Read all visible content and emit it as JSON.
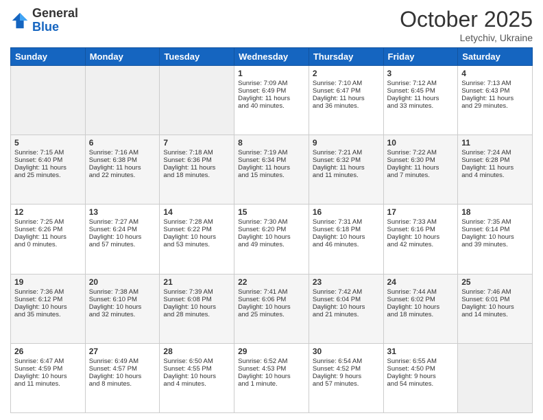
{
  "header": {
    "logo_general": "General",
    "logo_blue": "Blue",
    "month": "October 2025",
    "location": "Letychiv, Ukraine"
  },
  "weekdays": [
    "Sunday",
    "Monday",
    "Tuesday",
    "Wednesday",
    "Thursday",
    "Friday",
    "Saturday"
  ],
  "rows": [
    [
      {
        "day": "",
        "info": ""
      },
      {
        "day": "",
        "info": ""
      },
      {
        "day": "",
        "info": ""
      },
      {
        "day": "1",
        "info": "Sunrise: 7:09 AM\nSunset: 6:49 PM\nDaylight: 11 hours\nand 40 minutes."
      },
      {
        "day": "2",
        "info": "Sunrise: 7:10 AM\nSunset: 6:47 PM\nDaylight: 11 hours\nand 36 minutes."
      },
      {
        "day": "3",
        "info": "Sunrise: 7:12 AM\nSunset: 6:45 PM\nDaylight: 11 hours\nand 33 minutes."
      },
      {
        "day": "4",
        "info": "Sunrise: 7:13 AM\nSunset: 6:43 PM\nDaylight: 11 hours\nand 29 minutes."
      }
    ],
    [
      {
        "day": "5",
        "info": "Sunrise: 7:15 AM\nSunset: 6:40 PM\nDaylight: 11 hours\nand 25 minutes."
      },
      {
        "day": "6",
        "info": "Sunrise: 7:16 AM\nSunset: 6:38 PM\nDaylight: 11 hours\nand 22 minutes."
      },
      {
        "day": "7",
        "info": "Sunrise: 7:18 AM\nSunset: 6:36 PM\nDaylight: 11 hours\nand 18 minutes."
      },
      {
        "day": "8",
        "info": "Sunrise: 7:19 AM\nSunset: 6:34 PM\nDaylight: 11 hours\nand 15 minutes."
      },
      {
        "day": "9",
        "info": "Sunrise: 7:21 AM\nSunset: 6:32 PM\nDaylight: 11 hours\nand 11 minutes."
      },
      {
        "day": "10",
        "info": "Sunrise: 7:22 AM\nSunset: 6:30 PM\nDaylight: 11 hours\nand 7 minutes."
      },
      {
        "day": "11",
        "info": "Sunrise: 7:24 AM\nSunset: 6:28 PM\nDaylight: 11 hours\nand 4 minutes."
      }
    ],
    [
      {
        "day": "12",
        "info": "Sunrise: 7:25 AM\nSunset: 6:26 PM\nDaylight: 11 hours\nand 0 minutes."
      },
      {
        "day": "13",
        "info": "Sunrise: 7:27 AM\nSunset: 6:24 PM\nDaylight: 10 hours\nand 57 minutes."
      },
      {
        "day": "14",
        "info": "Sunrise: 7:28 AM\nSunset: 6:22 PM\nDaylight: 10 hours\nand 53 minutes."
      },
      {
        "day": "15",
        "info": "Sunrise: 7:30 AM\nSunset: 6:20 PM\nDaylight: 10 hours\nand 49 minutes."
      },
      {
        "day": "16",
        "info": "Sunrise: 7:31 AM\nSunset: 6:18 PM\nDaylight: 10 hours\nand 46 minutes."
      },
      {
        "day": "17",
        "info": "Sunrise: 7:33 AM\nSunset: 6:16 PM\nDaylight: 10 hours\nand 42 minutes."
      },
      {
        "day": "18",
        "info": "Sunrise: 7:35 AM\nSunset: 6:14 PM\nDaylight: 10 hours\nand 39 minutes."
      }
    ],
    [
      {
        "day": "19",
        "info": "Sunrise: 7:36 AM\nSunset: 6:12 PM\nDaylight: 10 hours\nand 35 minutes."
      },
      {
        "day": "20",
        "info": "Sunrise: 7:38 AM\nSunset: 6:10 PM\nDaylight: 10 hours\nand 32 minutes."
      },
      {
        "day": "21",
        "info": "Sunrise: 7:39 AM\nSunset: 6:08 PM\nDaylight: 10 hours\nand 28 minutes."
      },
      {
        "day": "22",
        "info": "Sunrise: 7:41 AM\nSunset: 6:06 PM\nDaylight: 10 hours\nand 25 minutes."
      },
      {
        "day": "23",
        "info": "Sunrise: 7:42 AM\nSunset: 6:04 PM\nDaylight: 10 hours\nand 21 minutes."
      },
      {
        "day": "24",
        "info": "Sunrise: 7:44 AM\nSunset: 6:02 PM\nDaylight: 10 hours\nand 18 minutes."
      },
      {
        "day": "25",
        "info": "Sunrise: 7:46 AM\nSunset: 6:01 PM\nDaylight: 10 hours\nand 14 minutes."
      }
    ],
    [
      {
        "day": "26",
        "info": "Sunrise: 6:47 AM\nSunset: 4:59 PM\nDaylight: 10 hours\nand 11 minutes."
      },
      {
        "day": "27",
        "info": "Sunrise: 6:49 AM\nSunset: 4:57 PM\nDaylight: 10 hours\nand 8 minutes."
      },
      {
        "day": "28",
        "info": "Sunrise: 6:50 AM\nSunset: 4:55 PM\nDaylight: 10 hours\nand 4 minutes."
      },
      {
        "day": "29",
        "info": "Sunrise: 6:52 AM\nSunset: 4:53 PM\nDaylight: 10 hours\nand 1 minute."
      },
      {
        "day": "30",
        "info": "Sunrise: 6:54 AM\nSunset: 4:52 PM\nDaylight: 9 hours\nand 57 minutes."
      },
      {
        "day": "31",
        "info": "Sunrise: 6:55 AM\nSunset: 4:50 PM\nDaylight: 9 hours\nand 54 minutes."
      },
      {
        "day": "",
        "info": ""
      }
    ]
  ]
}
